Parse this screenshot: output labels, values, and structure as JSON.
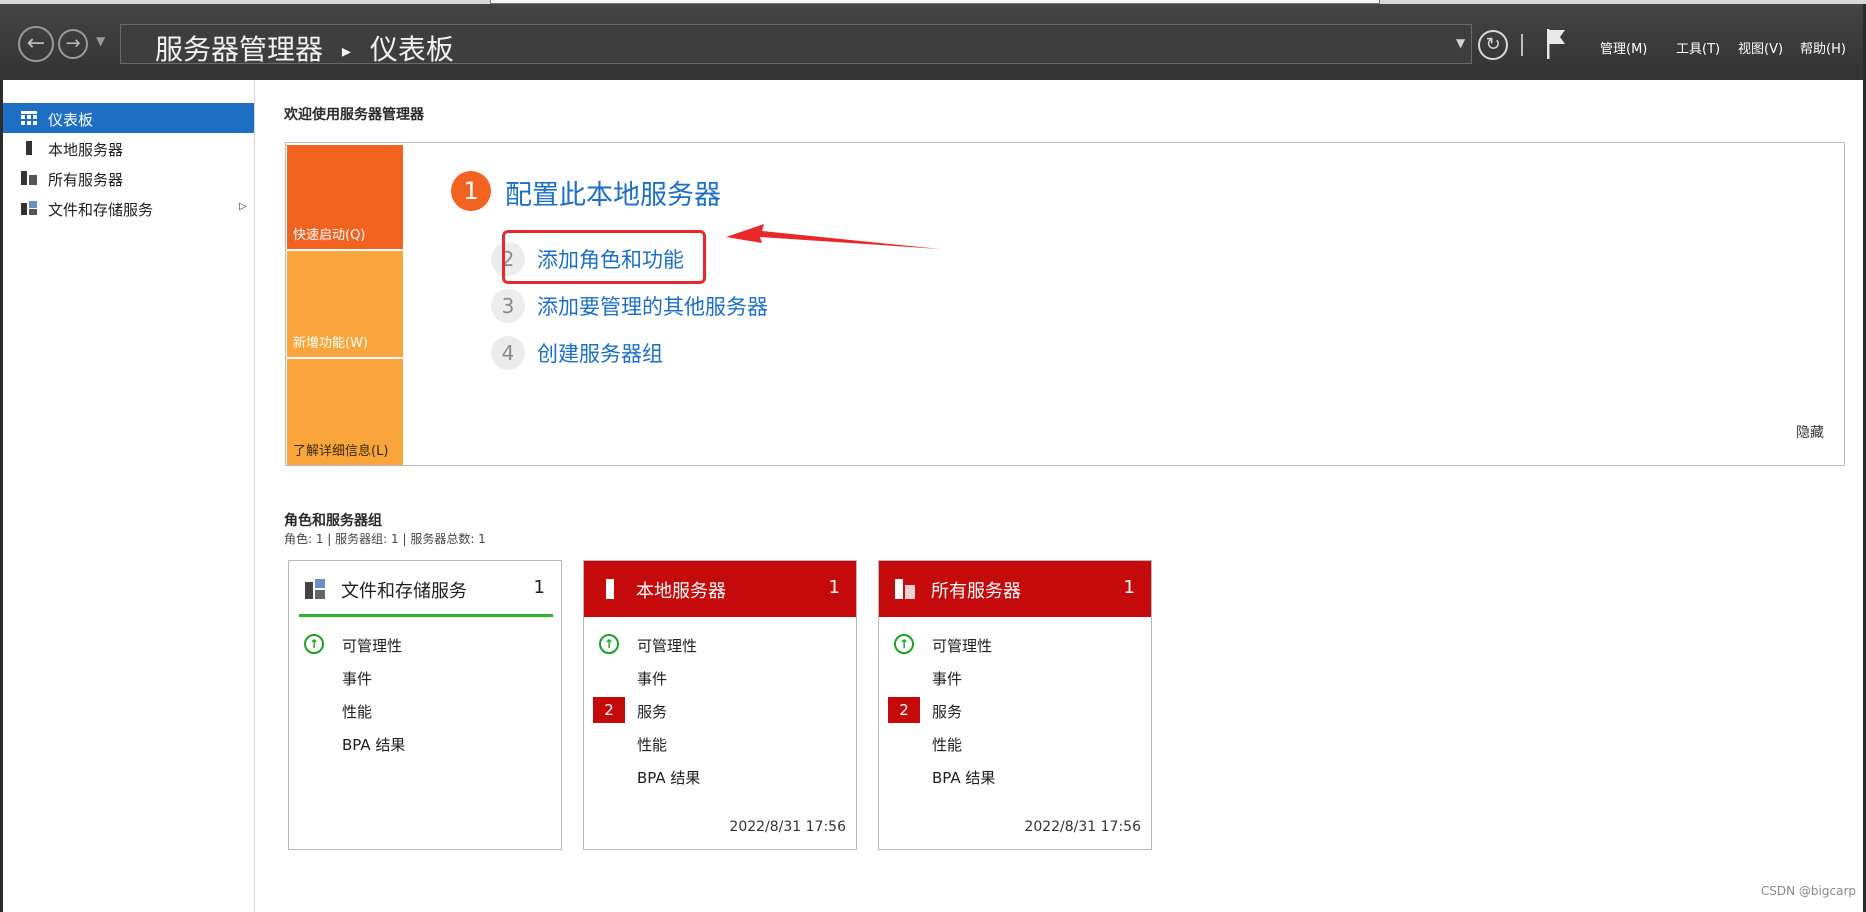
{
  "header": {
    "breadcrumb_app": "服务器管理器",
    "breadcrumb_sep": "▸",
    "breadcrumb_page": "仪表板",
    "menus": [
      "管理(M)",
      "工具(T)",
      "视图(V)",
      "帮助(H)"
    ],
    "icons": {
      "back": "back-arrow-icon",
      "forward": "forward-arrow-icon",
      "refresh": "refresh-icon",
      "flag": "notification-flag-icon"
    }
  },
  "sidebar": {
    "items": [
      {
        "label": "仪表板",
        "icon": "dashboard-icon",
        "active": true
      },
      {
        "label": "本地服务器",
        "icon": "server-icon"
      },
      {
        "label": "所有服务器",
        "icon": "servers-icon"
      },
      {
        "label": "文件和存储服务",
        "icon": "file-storage-icon",
        "expandable": true
      }
    ]
  },
  "main": {
    "welcome_title": "欢迎使用服务器管理器",
    "quickstart": {
      "tabs": [
        "快速启动(Q)",
        "新增功能(W)",
        "了解详细信息(L)"
      ],
      "step1": {
        "num": "1",
        "label": "配置此本地服务器"
      },
      "steps": [
        {
          "num": "2",
          "label": "添加角色和功能"
        },
        {
          "num": "3",
          "label": "添加要管理的其他服务器"
        },
        {
          "num": "4",
          "label": "创建服务器组"
        }
      ],
      "hide_label": "隐藏"
    },
    "roles": {
      "title": "角色和服务器组",
      "subtitle": "角色: 1 | 服务器组: 1 | 服务器总数: 1",
      "cards": [
        {
          "title": "文件和存储服务",
          "count": "1",
          "style": "white",
          "rows": [
            "可管理性",
            "事件",
            "性能",
            "BPA 结果"
          ],
          "timestamp": ""
        },
        {
          "title": "本地服务器",
          "count": "1",
          "style": "red",
          "rows": [
            "可管理性",
            "事件",
            "服务",
            "性能",
            "BPA 结果"
          ],
          "service_badge": "2",
          "timestamp": "2022/8/31 17:56"
        },
        {
          "title": "所有服务器",
          "count": "1",
          "style": "red",
          "rows": [
            "可管理性",
            "事件",
            "服务",
            "性能",
            "BPA 结果"
          ],
          "service_badge": "2",
          "timestamp": "2022/8/31 17:56"
        }
      ]
    }
  },
  "colors": {
    "accent_blue": "#1e6fc4",
    "orange": "#f26322",
    "light_orange": "#f9a53b",
    "tile_red": "#c40a0a",
    "status_green": "#1f9e2a",
    "highlight_red": "#e8282b"
  },
  "watermark": "CSDN @bigcarp"
}
